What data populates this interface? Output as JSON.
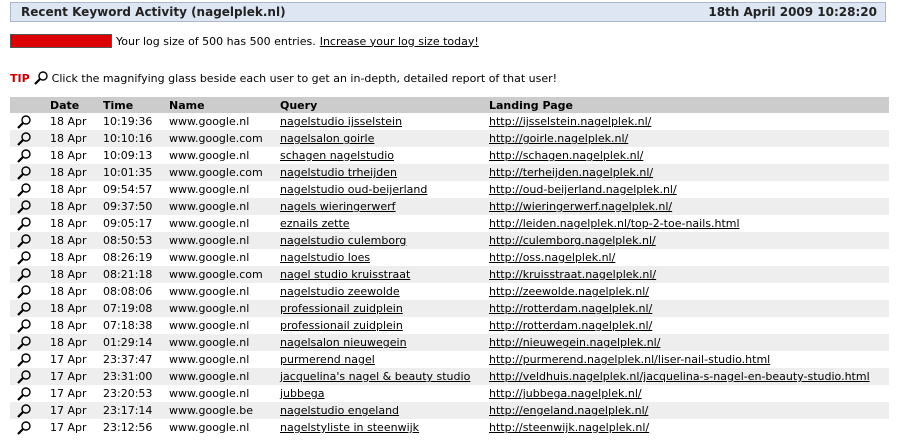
{
  "header": {
    "title": "Recent Keyword Activity (nagelplek.nl)",
    "date": "18th April 2009 10:28:20"
  },
  "log": {
    "text": "Your log size of 500 has 500 entries.",
    "link": "Increase your log size today!",
    "fill_fraction": 1.0,
    "bar_color": "#dd0000"
  },
  "tip": {
    "label": "TIP",
    "text": "Click the magnifying glass beside each user to get an in-depth, detailed report of that user!"
  },
  "table": {
    "columns": [
      "Date",
      "Time",
      "Name",
      "Query",
      "Landing Page"
    ],
    "rows": [
      {
        "date": "18 Apr",
        "time": "10:19:36",
        "name": "www.google.nl",
        "query": "nagelstudio ijsselstein",
        "landing": "http://ijsselstein.nagelplek.nl/"
      },
      {
        "date": "18 Apr",
        "time": "10:10:16",
        "name": "www.google.com",
        "query": "nagelsalon goirle",
        "landing": "http://goirle.nagelplek.nl/"
      },
      {
        "date": "18 Apr",
        "time": "10:09:13",
        "name": "www.google.nl",
        "query": "schagen nagelstudio",
        "landing": "http://schagen.nagelplek.nl/"
      },
      {
        "date": "18 Apr",
        "time": "10:01:35",
        "name": "www.google.com",
        "query": "nagelstudio trheijden",
        "landing": "http://terheijden.nagelplek.nl/"
      },
      {
        "date": "18 Apr",
        "time": "09:54:57",
        "name": "www.google.nl",
        "query": "nagelstudio oud-beijerland",
        "landing": "http://oud-beijerland.nagelplek.nl/"
      },
      {
        "date": "18 Apr",
        "time": "09:37:50",
        "name": "www.google.nl",
        "query": "nagels wieringerwerf",
        "landing": "http://wieringerwerf.nagelplek.nl/"
      },
      {
        "date": "18 Apr",
        "time": "09:05:17",
        "name": "www.google.nl",
        "query": "eznails zette",
        "landing": "http://leiden.nagelplek.nl/top-2-toe-nails.html"
      },
      {
        "date": "18 Apr",
        "time": "08:50:53",
        "name": "www.google.nl",
        "query": "nagelstudio culemborg",
        "landing": "http://culemborg.nagelplek.nl/"
      },
      {
        "date": "18 Apr",
        "time": "08:26:19",
        "name": "www.google.nl",
        "query": "nagelstudio loes",
        "landing": "http://oss.nagelplek.nl/"
      },
      {
        "date": "18 Apr",
        "time": "08:21:18",
        "name": "www.google.com",
        "query": "nagel studio kruisstraat",
        "landing": "http://kruisstraat.nagelplek.nl/"
      },
      {
        "date": "18 Apr",
        "time": "08:08:06",
        "name": "www.google.nl",
        "query": "nagelstudio zeewolde",
        "landing": "http://zeewolde.nagelplek.nl/"
      },
      {
        "date": "18 Apr",
        "time": "07:19:08",
        "name": "www.google.nl",
        "query": "professionail zuidplein",
        "landing": "http://rotterdam.nagelplek.nl/"
      },
      {
        "date": "18 Apr",
        "time": "07:18:38",
        "name": "www.google.nl",
        "query": "professionail zuidplein",
        "landing": "http://rotterdam.nagelplek.nl/"
      },
      {
        "date": "18 Apr",
        "time": "01:29:14",
        "name": "www.google.nl",
        "query": "nagelsalon nieuwegein",
        "landing": "http://nieuwegein.nagelplek.nl/"
      },
      {
        "date": "17 Apr",
        "time": "23:37:47",
        "name": "www.google.nl",
        "query": "purmerend nagel",
        "landing": "http://purmerend.nagelplek.nl/liser-nail-studio.html"
      },
      {
        "date": "17 Apr",
        "time": "23:31:00",
        "name": "www.google.nl",
        "query": "jacquelina's nagel & beauty studio",
        "landing": "http://veldhuis.nagelplek.nl/jacquelina-s-nagel-en-beauty-studio.html"
      },
      {
        "date": "17 Apr",
        "time": "23:20:53",
        "name": "www.google.nl",
        "query": "jubbega",
        "landing": "http://jubbega.nagelplek.nl/"
      },
      {
        "date": "17 Apr",
        "time": "23:17:14",
        "name": "www.google.be",
        "query": "nagelstudio engeland",
        "landing": "http://engeland.nagelplek.nl/"
      },
      {
        "date": "17 Apr",
        "time": "23:12:56",
        "name": "www.google.nl",
        "query": "nagelstyliste in steenwijk",
        "landing": "http://steenwijk.nagelplek.nl/"
      }
    ]
  },
  "icons": {
    "detail": "magnifying-glass-icon"
  }
}
